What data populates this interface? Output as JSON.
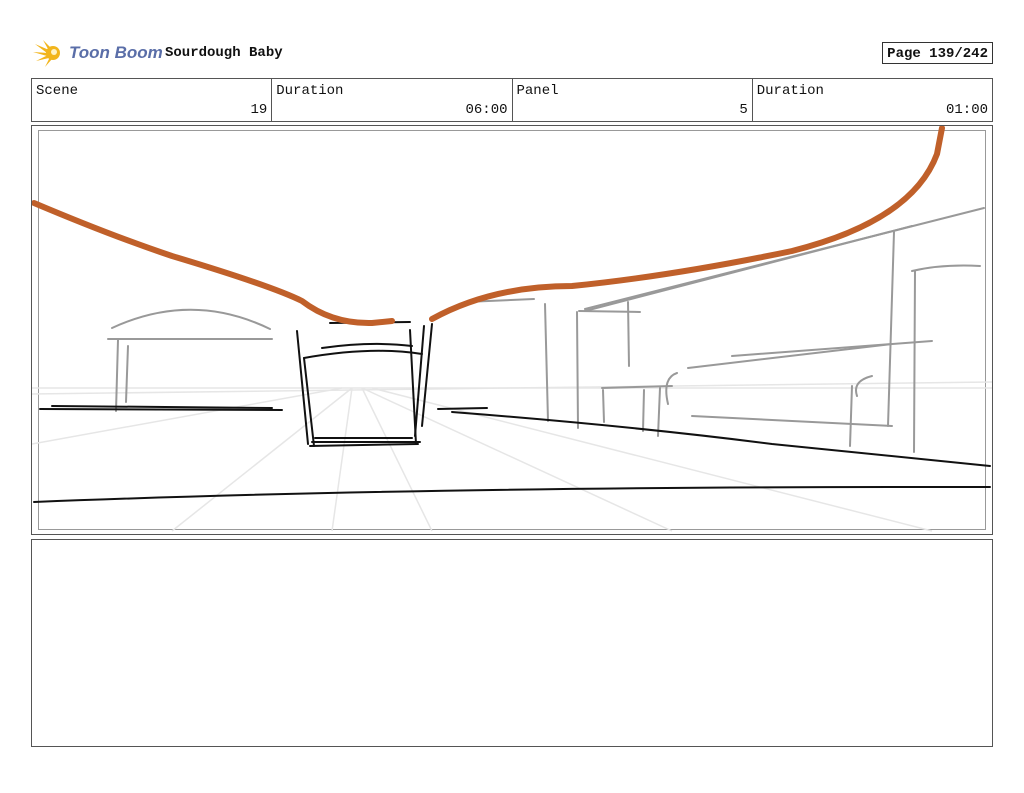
{
  "header": {
    "logo_text": "Toon Boom",
    "project_title": "Sourdough Baby",
    "page_label": "Page 139/242"
  },
  "info": [
    {
      "label": "Scene",
      "value": "19"
    },
    {
      "label": "Duration",
      "value": "06:00"
    },
    {
      "label": "Panel",
      "value": "5"
    },
    {
      "label": "Duration",
      "value": "01:00"
    }
  ],
  "colors": {
    "accent_stroke": "#c0602a",
    "logo_blue": "#5a6ea8",
    "logo_yellow": "#f2b51c"
  },
  "notes": {
    "text": ""
  }
}
